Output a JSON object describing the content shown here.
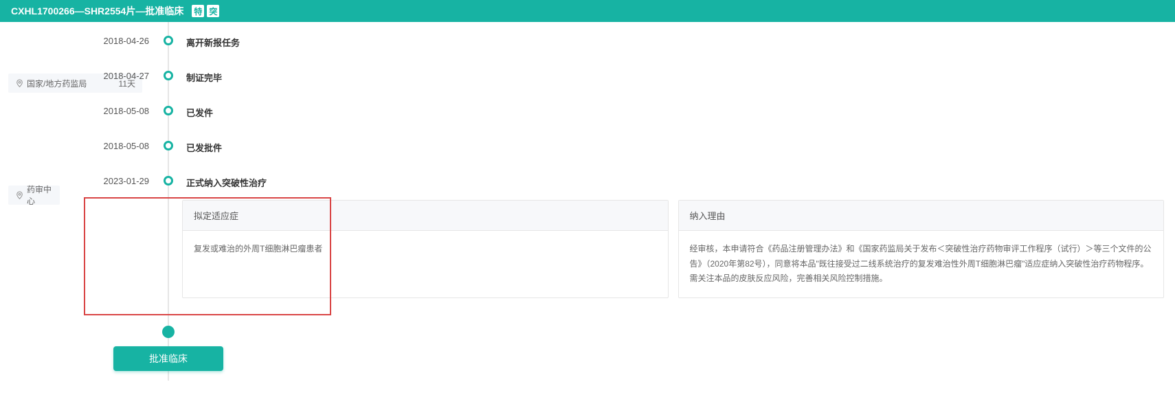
{
  "header": {
    "title": "CXHL1700266—SHR2554片—批准临床",
    "badge1": "特",
    "badge2": "突"
  },
  "stages": {
    "stage1_label": "国家/地方药监局",
    "stage1_days": "11天",
    "stage2_label": "药审中心"
  },
  "events": [
    {
      "date": "2018-04-26",
      "title": "离开新报任务"
    },
    {
      "date": "2018-04-27",
      "title": "制证完毕"
    },
    {
      "date": "2018-05-08",
      "title": "已发件"
    },
    {
      "date": "2018-05-08",
      "title": "已发批件"
    },
    {
      "date": "2023-01-29",
      "title": "正式纳入突破性治疗"
    }
  ],
  "details": {
    "box1_header": "拟定适应症",
    "box1_body": "复发或难治的外周T细胞淋巴瘤患者",
    "box2_header": "纳入理由",
    "box2_body": "经审核，本申请符合《药品注册管理办法》和《国家药监局关于发布＜突破性治疗药物审评工作程序（试行）＞等三个文件的公告》（2020年第82号），同意将本品\"既往接受过二线系统治疗的复发难治性外周T细胞淋巴瘤\"适应症纳入突破性治疗药物程序。需关注本品的皮肤反应风险，完善相关风险控制措施。"
  },
  "bottom": {
    "approve_label": "批准临床"
  }
}
